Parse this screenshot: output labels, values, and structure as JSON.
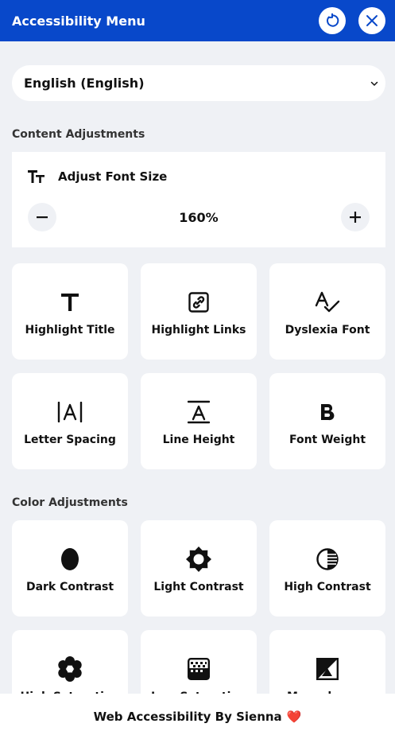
{
  "header": {
    "title": "Accessibility Menu"
  },
  "language": {
    "selected": "English (English)"
  },
  "content_section": {
    "title": "Content Adjustments"
  },
  "font_size": {
    "label": "Adjust Font Size",
    "value": "160%"
  },
  "content_cards": [
    {
      "label": "Highlight Title",
      "icon": "title-icon"
    },
    {
      "label": "Highlight Links",
      "icon": "link-icon"
    },
    {
      "label": "Dyslexia Font",
      "icon": "dyslexia-font-icon"
    },
    {
      "label": "Letter Spacing",
      "icon": "letter-spacing-icon"
    },
    {
      "label": "Line Height",
      "icon": "line-height-icon"
    },
    {
      "label": "Font Weight",
      "icon": "bold-icon"
    }
  ],
  "color_section": {
    "title": "Color Adjustments"
  },
  "color_cards": [
    {
      "label": "Dark Contrast",
      "icon": "dark-contrast-icon"
    },
    {
      "label": "Light Contrast",
      "icon": "sun-icon"
    },
    {
      "label": "High Contrast",
      "icon": "high-contrast-icon"
    },
    {
      "label": "High Saturation",
      "icon": "flower-icon"
    },
    {
      "label": "Low Saturation",
      "icon": "low-saturation-icon"
    },
    {
      "label": "Monochrome",
      "icon": "monochrome-icon"
    }
  ],
  "footer": {
    "text": "Web Accessibility By Sienna",
    "heart": "❤️"
  },
  "colors": {
    "header": "#0848ca",
    "background": "#eff1f5"
  }
}
